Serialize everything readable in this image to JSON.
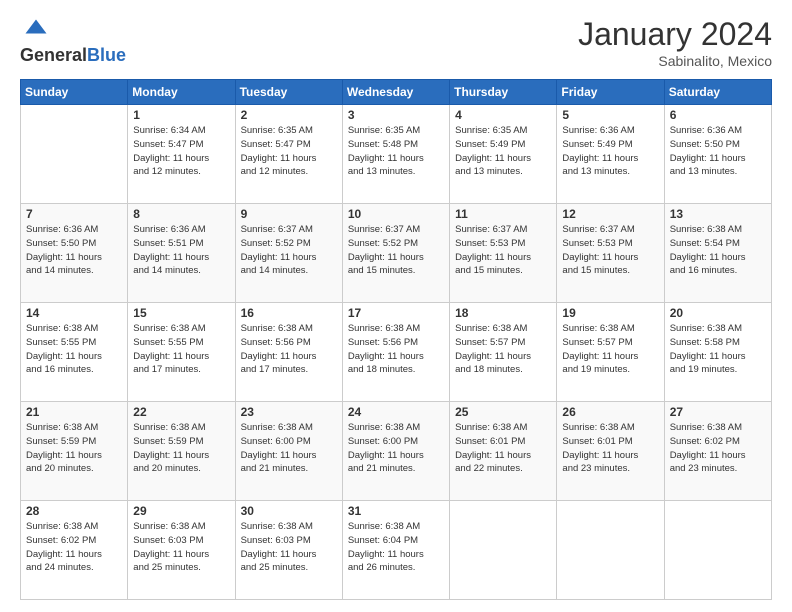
{
  "header": {
    "logo_general": "General",
    "logo_blue": "Blue",
    "month_title": "January 2024",
    "subtitle": "Sabinalito, Mexico"
  },
  "days_of_week": [
    "Sunday",
    "Monday",
    "Tuesday",
    "Wednesday",
    "Thursday",
    "Friday",
    "Saturday"
  ],
  "weeks": [
    [
      {
        "day": "",
        "info": ""
      },
      {
        "day": "1",
        "info": "Sunrise: 6:34 AM\nSunset: 5:47 PM\nDaylight: 11 hours\nand 12 minutes."
      },
      {
        "day": "2",
        "info": "Sunrise: 6:35 AM\nSunset: 5:47 PM\nDaylight: 11 hours\nand 12 minutes."
      },
      {
        "day": "3",
        "info": "Sunrise: 6:35 AM\nSunset: 5:48 PM\nDaylight: 11 hours\nand 13 minutes."
      },
      {
        "day": "4",
        "info": "Sunrise: 6:35 AM\nSunset: 5:49 PM\nDaylight: 11 hours\nand 13 minutes."
      },
      {
        "day": "5",
        "info": "Sunrise: 6:36 AM\nSunset: 5:49 PM\nDaylight: 11 hours\nand 13 minutes."
      },
      {
        "day": "6",
        "info": "Sunrise: 6:36 AM\nSunset: 5:50 PM\nDaylight: 11 hours\nand 13 minutes."
      }
    ],
    [
      {
        "day": "7",
        "info": "Sunrise: 6:36 AM\nSunset: 5:50 PM\nDaylight: 11 hours\nand 14 minutes."
      },
      {
        "day": "8",
        "info": "Sunrise: 6:36 AM\nSunset: 5:51 PM\nDaylight: 11 hours\nand 14 minutes."
      },
      {
        "day": "9",
        "info": "Sunrise: 6:37 AM\nSunset: 5:52 PM\nDaylight: 11 hours\nand 14 minutes."
      },
      {
        "day": "10",
        "info": "Sunrise: 6:37 AM\nSunset: 5:52 PM\nDaylight: 11 hours\nand 15 minutes."
      },
      {
        "day": "11",
        "info": "Sunrise: 6:37 AM\nSunset: 5:53 PM\nDaylight: 11 hours\nand 15 minutes."
      },
      {
        "day": "12",
        "info": "Sunrise: 6:37 AM\nSunset: 5:53 PM\nDaylight: 11 hours\nand 15 minutes."
      },
      {
        "day": "13",
        "info": "Sunrise: 6:38 AM\nSunset: 5:54 PM\nDaylight: 11 hours\nand 16 minutes."
      }
    ],
    [
      {
        "day": "14",
        "info": "Sunrise: 6:38 AM\nSunset: 5:55 PM\nDaylight: 11 hours\nand 16 minutes."
      },
      {
        "day": "15",
        "info": "Sunrise: 6:38 AM\nSunset: 5:55 PM\nDaylight: 11 hours\nand 17 minutes."
      },
      {
        "day": "16",
        "info": "Sunrise: 6:38 AM\nSunset: 5:56 PM\nDaylight: 11 hours\nand 17 minutes."
      },
      {
        "day": "17",
        "info": "Sunrise: 6:38 AM\nSunset: 5:56 PM\nDaylight: 11 hours\nand 18 minutes."
      },
      {
        "day": "18",
        "info": "Sunrise: 6:38 AM\nSunset: 5:57 PM\nDaylight: 11 hours\nand 18 minutes."
      },
      {
        "day": "19",
        "info": "Sunrise: 6:38 AM\nSunset: 5:57 PM\nDaylight: 11 hours\nand 19 minutes."
      },
      {
        "day": "20",
        "info": "Sunrise: 6:38 AM\nSunset: 5:58 PM\nDaylight: 11 hours\nand 19 minutes."
      }
    ],
    [
      {
        "day": "21",
        "info": "Sunrise: 6:38 AM\nSunset: 5:59 PM\nDaylight: 11 hours\nand 20 minutes."
      },
      {
        "day": "22",
        "info": "Sunrise: 6:38 AM\nSunset: 5:59 PM\nDaylight: 11 hours\nand 20 minutes."
      },
      {
        "day": "23",
        "info": "Sunrise: 6:38 AM\nSunset: 6:00 PM\nDaylight: 11 hours\nand 21 minutes."
      },
      {
        "day": "24",
        "info": "Sunrise: 6:38 AM\nSunset: 6:00 PM\nDaylight: 11 hours\nand 21 minutes."
      },
      {
        "day": "25",
        "info": "Sunrise: 6:38 AM\nSunset: 6:01 PM\nDaylight: 11 hours\nand 22 minutes."
      },
      {
        "day": "26",
        "info": "Sunrise: 6:38 AM\nSunset: 6:01 PM\nDaylight: 11 hours\nand 23 minutes."
      },
      {
        "day": "27",
        "info": "Sunrise: 6:38 AM\nSunset: 6:02 PM\nDaylight: 11 hours\nand 23 minutes."
      }
    ],
    [
      {
        "day": "28",
        "info": "Sunrise: 6:38 AM\nSunset: 6:02 PM\nDaylight: 11 hours\nand 24 minutes."
      },
      {
        "day": "29",
        "info": "Sunrise: 6:38 AM\nSunset: 6:03 PM\nDaylight: 11 hours\nand 25 minutes."
      },
      {
        "day": "30",
        "info": "Sunrise: 6:38 AM\nSunset: 6:03 PM\nDaylight: 11 hours\nand 25 minutes."
      },
      {
        "day": "31",
        "info": "Sunrise: 6:38 AM\nSunset: 6:04 PM\nDaylight: 11 hours\nand 26 minutes."
      },
      {
        "day": "",
        "info": ""
      },
      {
        "day": "",
        "info": ""
      },
      {
        "day": "",
        "info": ""
      }
    ]
  ]
}
